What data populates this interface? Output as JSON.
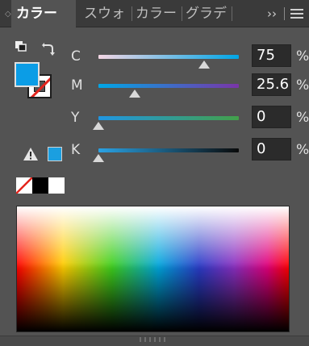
{
  "tabs": [
    {
      "label": "カラー",
      "active": true
    },
    {
      "label": "スウォ",
      "active": false
    },
    {
      "label": "カラー",
      "active": false
    },
    {
      "label": "グラデ",
      "active": false
    }
  ],
  "tab_overflow": "››",
  "colors": {
    "fill": "#0b9de6",
    "websafe": "#1b9fe0",
    "c_track": [
      "#f4d6e4",
      "#00a6e6"
    ],
    "m_track": [
      "#00a6e6",
      "#7a35a8"
    ],
    "y_track": [
      "#2096e2",
      "#43a04a"
    ],
    "k_track": [
      "#2aa2e4",
      "#0a0a0a"
    ]
  },
  "channels": [
    {
      "name": "C",
      "value": "75",
      "level": 75,
      "unit": "%"
    },
    {
      "name": "M",
      "value": "25.6",
      "level": 25.6,
      "unit": "%"
    },
    {
      "name": "Y",
      "value": "0",
      "level": 0,
      "unit": "%"
    },
    {
      "name": "K",
      "value": "0",
      "level": 0,
      "unit": "%"
    }
  ],
  "icons": {
    "defaults": "default-fill-stroke-icon",
    "swap": "swap-fill-stroke-icon",
    "warning": "out-of-gamut-warning-icon",
    "menu": "panel-menu-icon"
  }
}
